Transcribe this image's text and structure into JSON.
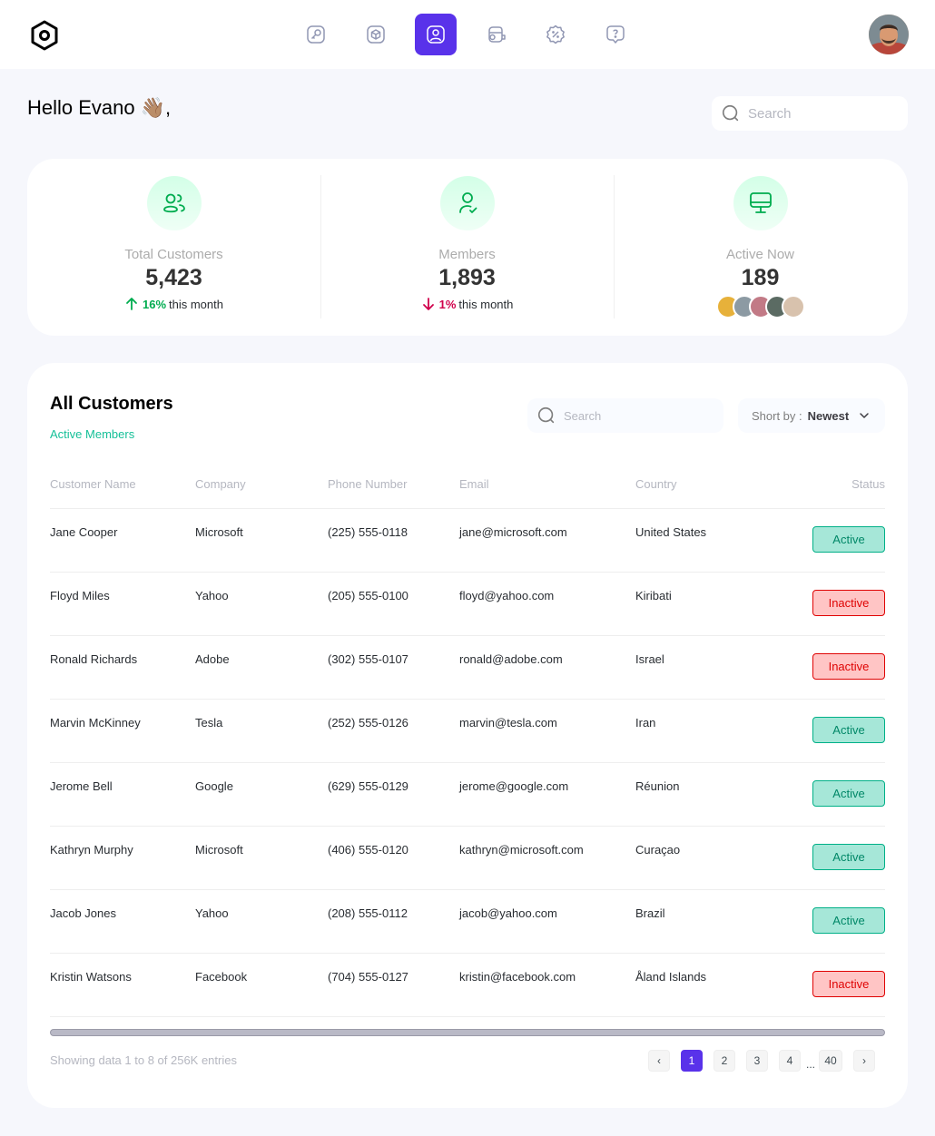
{
  "nav": {
    "items": [
      {
        "icon": "key-icon",
        "active": false
      },
      {
        "icon": "cube-icon",
        "active": false
      },
      {
        "icon": "user-square-icon",
        "active": true
      },
      {
        "icon": "wallet-money-icon",
        "active": false
      },
      {
        "icon": "discount-shape-icon",
        "active": false
      },
      {
        "icon": "message-question-icon",
        "active": false
      }
    ],
    "accent": "#5932ea"
  },
  "greeting": {
    "text": "Hello Evano",
    "emoji": "👋🏽,"
  },
  "top_search": {
    "placeholder": "Search"
  },
  "stats": {
    "total_customers": {
      "label": "Total Customers",
      "value": "5,423",
      "trend": "16%",
      "trend_suffix": "this month",
      "direction": "up"
    },
    "members": {
      "label": "Members",
      "value": "1,893",
      "trend": "1%",
      "trend_suffix": "this month",
      "direction": "down"
    },
    "active_now": {
      "label": "Active Now",
      "value": "189"
    }
  },
  "customers": {
    "title": "All Customers",
    "subtitle": "Active Members",
    "search_placeholder": "Search",
    "sort_label": "Short by :",
    "sort_value": "Newest",
    "columns": [
      "Customer Name",
      "Company",
      "Phone Number",
      "Email",
      "Country",
      "Status"
    ],
    "rows": [
      {
        "name": "Jane Cooper",
        "company": "Microsoft",
        "phone": "(225) 555-0118",
        "email": "jane@microsoft.com",
        "country": "United States",
        "status": "Active"
      },
      {
        "name": "Floyd Miles",
        "company": "Yahoo",
        "phone": "(205) 555-0100",
        "email": "floyd@yahoo.com",
        "country": "Kiribati",
        "status": "Inactive"
      },
      {
        "name": "Ronald Richards",
        "company": "Adobe",
        "phone": "(302) 555-0107",
        "email": "ronald@adobe.com",
        "country": "Israel",
        "status": "Inactive"
      },
      {
        "name": "Marvin McKinney",
        "company": "Tesla",
        "phone": "(252) 555-0126",
        "email": "marvin@tesla.com",
        "country": "Iran",
        "status": "Active"
      },
      {
        "name": "Jerome Bell",
        "company": "Google",
        "phone": "(629) 555-0129",
        "email": "jerome@google.com",
        "country": "Réunion",
        "status": "Active"
      },
      {
        "name": "Kathryn Murphy",
        "company": "Microsoft",
        "phone": "(406) 555-0120",
        "email": "kathryn@microsoft.com",
        "country": "Curaçao",
        "status": "Active"
      },
      {
        "name": "Jacob Jones",
        "company": "Yahoo",
        "phone": "(208) 555-0112",
        "email": "jacob@yahoo.com",
        "country": "Brazil",
        "status": "Active"
      },
      {
        "name": "Kristin Watsons",
        "company": "Facebook",
        "phone": "(704) 555-0127",
        "email": "kristin@facebook.com",
        "country": "Åland Islands",
        "status": "Inactive"
      }
    ],
    "showing_text": "Showing data 1 to 8 of 256K entries",
    "pagination": {
      "prev": "‹",
      "pages": [
        "1",
        "2",
        "3",
        "4"
      ],
      "ellipsis": "...",
      "last": "40",
      "next": "›",
      "current": "1"
    }
  }
}
